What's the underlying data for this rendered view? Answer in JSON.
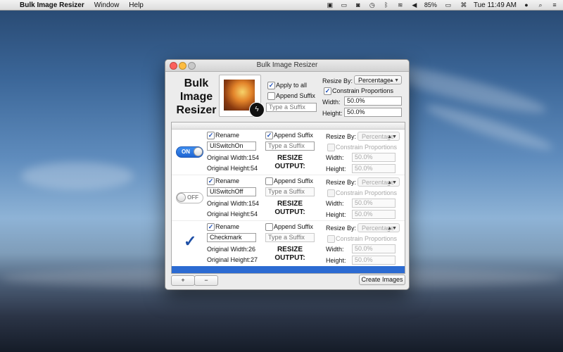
{
  "menubar": {
    "app_name": "Bulk Image Resizer",
    "menus": [
      "Window",
      "Help"
    ],
    "battery": "85%",
    "clock": "Tue 11:49 AM"
  },
  "window": {
    "title": "Bulk Image Resizer",
    "big_title": "Bulk Image Resizer"
  },
  "global": {
    "apply_to_all_label": "Apply to all",
    "apply_to_all_checked": true,
    "append_suffix_label": "Append Suffix",
    "append_suffix_checked": false,
    "suffix_placeholder": "Type a Suffix",
    "resize_by_label": "Resize By:",
    "resize_by_value": "Percentage",
    "constrain_label": "Constrain Proportions",
    "constrain_checked": true,
    "width_label": "Width:",
    "width_value": "50.0%",
    "height_label": "Height:",
    "height_value": "50.0%"
  },
  "labels": {
    "rename": "Rename",
    "append_suffix": "Append Suffix",
    "suffix_placeholder": "Type a Suffix",
    "resize_output": "RESIZE OUTPUT:",
    "resize_by": "Resize By:",
    "resize_by_value": "Percentage",
    "constrain": "Constrain Proportions",
    "width": "Width:",
    "height": "Height:",
    "width_value": "50.0%",
    "height_value": "50.0%",
    "original_width": "Original Width:",
    "original_height": "Original Height:"
  },
  "rows": [
    {
      "icon": "switch-on",
      "icon_text": "ON",
      "name": "UISwitchOn",
      "append_checked": true,
      "orig_w": "154",
      "orig_h": "54",
      "orig_w_text": "Original Width:154",
      "orig_h_text": "Original Height:54"
    },
    {
      "icon": "switch-off",
      "icon_text": "OFF",
      "name": "UISwitchOff",
      "append_checked": false,
      "orig_w": "154",
      "orig_h": "54",
      "orig_w_text": "Original Width:154",
      "orig_h_text": "Original Height:54"
    },
    {
      "icon": "checkmark",
      "icon_text": "✓",
      "name": "Checkmark",
      "append_checked": false,
      "orig_w": "26",
      "orig_h": "27",
      "orig_w_text": "Original Width:26",
      "orig_h_text": "Original Height:27"
    }
  ],
  "footer": {
    "add_label": "+",
    "remove_label": "−",
    "create_label": "Create Images"
  }
}
